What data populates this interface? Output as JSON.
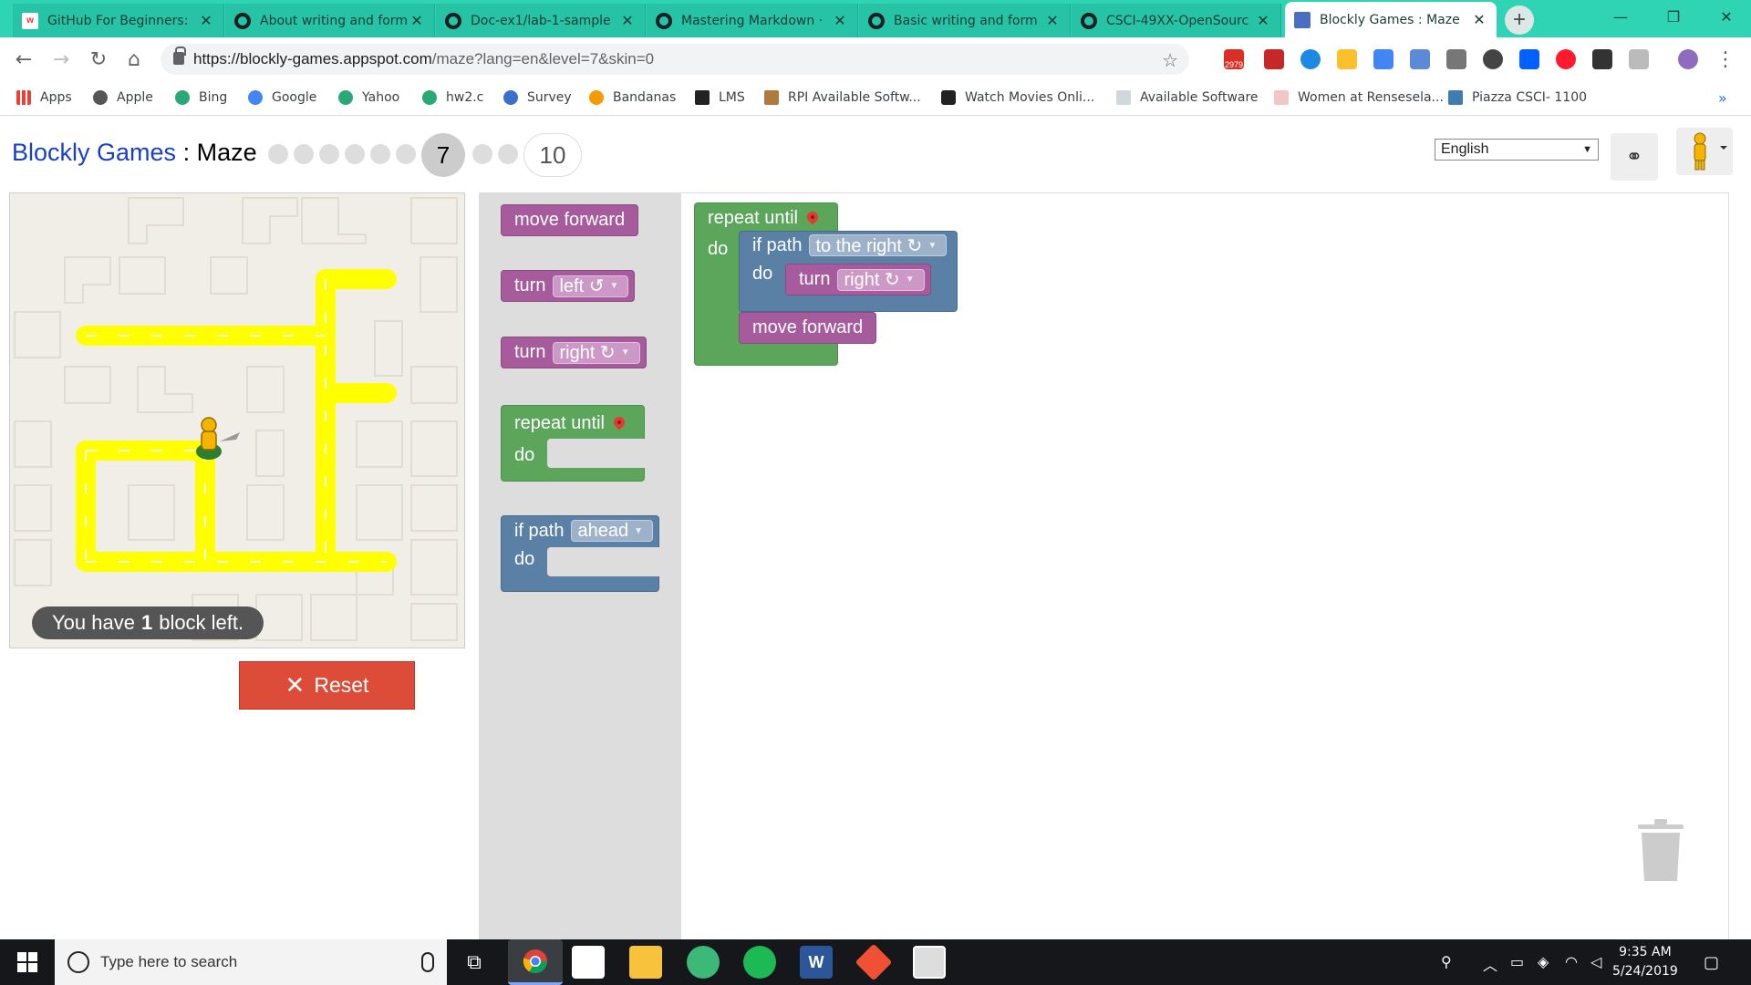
{
  "browser": {
    "tabs": [
      {
        "title": "GitHub For Beginners: "
      },
      {
        "title": "About writing and form"
      },
      {
        "title": "Doc-ex1/lab-1-sample"
      },
      {
        "title": "Mastering Markdown · "
      },
      {
        "title": "Basic writing and form"
      },
      {
        "title": "CSCI-49XX-OpenSourc"
      },
      {
        "title": "Blockly Games : Maze"
      }
    ],
    "url_host": "https://blockly-games.appspot.com",
    "url_path": "/maze?lang=en&level=7&skin=0",
    "gmail_badge": "2979",
    "bookmarks": [
      {
        "label": "Apps"
      },
      {
        "label": "Apple"
      },
      {
        "label": "Bing"
      },
      {
        "label": "Google"
      },
      {
        "label": "Yahoo"
      },
      {
        "label": "hw2.c"
      },
      {
        "label": "Survey"
      },
      {
        "label": "Bandanas"
      },
      {
        "label": "LMS"
      },
      {
        "label": "RPI Available Softw..."
      },
      {
        "label": "Watch Movies Onli..."
      },
      {
        "label": "Available Software"
      },
      {
        "label": "Women at Rensesela..."
      },
      {
        "label": "Piazza CSCI- 1100"
      }
    ],
    "bookmarks_more": "»"
  },
  "game": {
    "title_link": "Blockly Games",
    "title_sep": " : ",
    "title_name": "Maze",
    "current_level": "7",
    "last_level": "10",
    "language": "English",
    "status_prefix": "You have",
    "status_count": "1",
    "status_suffix": "block left.",
    "reset_label": "Reset"
  },
  "toolbox": {
    "move_forward": "move forward",
    "turn": "turn",
    "left": "left ↺",
    "right": "right ↻",
    "repeat_until": "repeat until",
    "do": "do",
    "if_path": "if path",
    "ahead": "ahead"
  },
  "program": {
    "repeat_until": "repeat until",
    "do": "do",
    "if_path": "if path",
    "direction": "to the right ↻",
    "turn": "turn",
    "turn_dir": "right ↻",
    "move_forward": "move forward"
  },
  "taskbar": {
    "search_placeholder": "Type here to search",
    "time": "9:35 AM",
    "date": "5/24/2019"
  },
  "colors": {
    "accent_tab": "#2ed4b4",
    "block_purple": "#a55b9c",
    "block_green": "#5ca65c",
    "block_blue": "#5b80a5",
    "reset_red": "#dd4b39",
    "path_yellow": "#ffff00"
  }
}
